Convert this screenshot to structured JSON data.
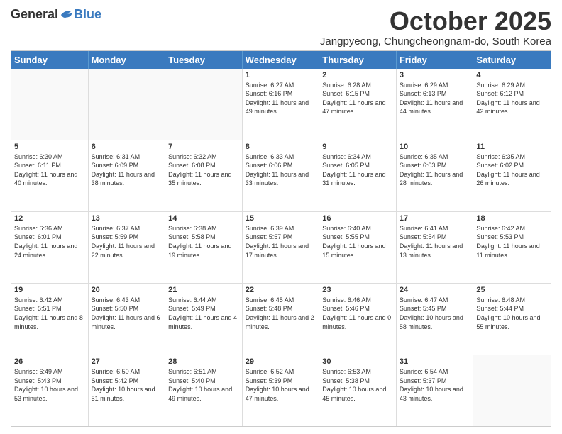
{
  "logo": {
    "general": "General",
    "blue": "Blue"
  },
  "title": "October 2025",
  "location": "Jangpyeong, Chungcheongnam-do, South Korea",
  "days_of_week": [
    "Sunday",
    "Monday",
    "Tuesday",
    "Wednesday",
    "Thursday",
    "Friday",
    "Saturday"
  ],
  "weeks": [
    [
      {
        "day": "",
        "info": "",
        "empty": true
      },
      {
        "day": "",
        "info": "",
        "empty": true
      },
      {
        "day": "",
        "info": "",
        "empty": true
      },
      {
        "day": "1",
        "info": "Sunrise: 6:27 AM\nSunset: 6:16 PM\nDaylight: 11 hours and 49 minutes."
      },
      {
        "day": "2",
        "info": "Sunrise: 6:28 AM\nSunset: 6:15 PM\nDaylight: 11 hours and 47 minutes."
      },
      {
        "day": "3",
        "info": "Sunrise: 6:29 AM\nSunset: 6:13 PM\nDaylight: 11 hours and 44 minutes."
      },
      {
        "day": "4",
        "info": "Sunrise: 6:29 AM\nSunset: 6:12 PM\nDaylight: 11 hours and 42 minutes."
      }
    ],
    [
      {
        "day": "5",
        "info": "Sunrise: 6:30 AM\nSunset: 6:11 PM\nDaylight: 11 hours and 40 minutes."
      },
      {
        "day": "6",
        "info": "Sunrise: 6:31 AM\nSunset: 6:09 PM\nDaylight: 11 hours and 38 minutes."
      },
      {
        "day": "7",
        "info": "Sunrise: 6:32 AM\nSunset: 6:08 PM\nDaylight: 11 hours and 35 minutes."
      },
      {
        "day": "8",
        "info": "Sunrise: 6:33 AM\nSunset: 6:06 PM\nDaylight: 11 hours and 33 minutes."
      },
      {
        "day": "9",
        "info": "Sunrise: 6:34 AM\nSunset: 6:05 PM\nDaylight: 11 hours and 31 minutes."
      },
      {
        "day": "10",
        "info": "Sunrise: 6:35 AM\nSunset: 6:03 PM\nDaylight: 11 hours and 28 minutes."
      },
      {
        "day": "11",
        "info": "Sunrise: 6:35 AM\nSunset: 6:02 PM\nDaylight: 11 hours and 26 minutes."
      }
    ],
    [
      {
        "day": "12",
        "info": "Sunrise: 6:36 AM\nSunset: 6:01 PM\nDaylight: 11 hours and 24 minutes."
      },
      {
        "day": "13",
        "info": "Sunrise: 6:37 AM\nSunset: 5:59 PM\nDaylight: 11 hours and 22 minutes."
      },
      {
        "day": "14",
        "info": "Sunrise: 6:38 AM\nSunset: 5:58 PM\nDaylight: 11 hours and 19 minutes."
      },
      {
        "day": "15",
        "info": "Sunrise: 6:39 AM\nSunset: 5:57 PM\nDaylight: 11 hours and 17 minutes."
      },
      {
        "day": "16",
        "info": "Sunrise: 6:40 AM\nSunset: 5:55 PM\nDaylight: 11 hours and 15 minutes."
      },
      {
        "day": "17",
        "info": "Sunrise: 6:41 AM\nSunset: 5:54 PM\nDaylight: 11 hours and 13 minutes."
      },
      {
        "day": "18",
        "info": "Sunrise: 6:42 AM\nSunset: 5:53 PM\nDaylight: 11 hours and 11 minutes."
      }
    ],
    [
      {
        "day": "19",
        "info": "Sunrise: 6:42 AM\nSunset: 5:51 PM\nDaylight: 11 hours and 8 minutes."
      },
      {
        "day": "20",
        "info": "Sunrise: 6:43 AM\nSunset: 5:50 PM\nDaylight: 11 hours and 6 minutes."
      },
      {
        "day": "21",
        "info": "Sunrise: 6:44 AM\nSunset: 5:49 PM\nDaylight: 11 hours and 4 minutes."
      },
      {
        "day": "22",
        "info": "Sunrise: 6:45 AM\nSunset: 5:48 PM\nDaylight: 11 hours and 2 minutes."
      },
      {
        "day": "23",
        "info": "Sunrise: 6:46 AM\nSunset: 5:46 PM\nDaylight: 11 hours and 0 minutes."
      },
      {
        "day": "24",
        "info": "Sunrise: 6:47 AM\nSunset: 5:45 PM\nDaylight: 10 hours and 58 minutes."
      },
      {
        "day": "25",
        "info": "Sunrise: 6:48 AM\nSunset: 5:44 PM\nDaylight: 10 hours and 55 minutes."
      }
    ],
    [
      {
        "day": "26",
        "info": "Sunrise: 6:49 AM\nSunset: 5:43 PM\nDaylight: 10 hours and 53 minutes."
      },
      {
        "day": "27",
        "info": "Sunrise: 6:50 AM\nSunset: 5:42 PM\nDaylight: 10 hours and 51 minutes."
      },
      {
        "day": "28",
        "info": "Sunrise: 6:51 AM\nSunset: 5:40 PM\nDaylight: 10 hours and 49 minutes."
      },
      {
        "day": "29",
        "info": "Sunrise: 6:52 AM\nSunset: 5:39 PM\nDaylight: 10 hours and 47 minutes."
      },
      {
        "day": "30",
        "info": "Sunrise: 6:53 AM\nSunset: 5:38 PM\nDaylight: 10 hours and 45 minutes."
      },
      {
        "day": "31",
        "info": "Sunrise: 6:54 AM\nSunset: 5:37 PM\nDaylight: 10 hours and 43 minutes."
      },
      {
        "day": "",
        "info": "",
        "empty": true
      }
    ]
  ]
}
